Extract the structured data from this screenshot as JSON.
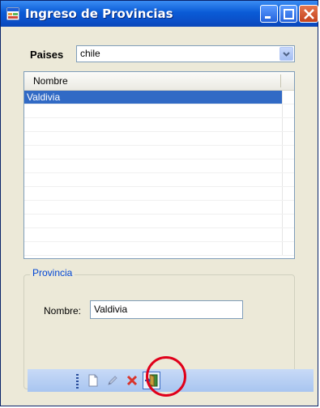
{
  "window": {
    "title": "Ingreso de Provincias",
    "accent": "#0a5bd6",
    "close_color": "#c4421c"
  },
  "paises": {
    "label": "Paises",
    "selected": "chile"
  },
  "grid": {
    "column_header": "Nombre",
    "selection_color": "#316ac5",
    "rows": [
      "Valdivia",
      "",
      "",
      "",
      "",
      "",
      "",
      "",
      "",
      "",
      "",
      ""
    ]
  },
  "provincia": {
    "group_title": "Provincia",
    "nombre_label": "Nombre:",
    "nombre_value": "Valdivia"
  },
  "toolbar": {
    "items": [
      "new-icon",
      "edit-icon",
      "delete-icon",
      "exit-icon"
    ],
    "highlight_color": "#e0001a"
  }
}
